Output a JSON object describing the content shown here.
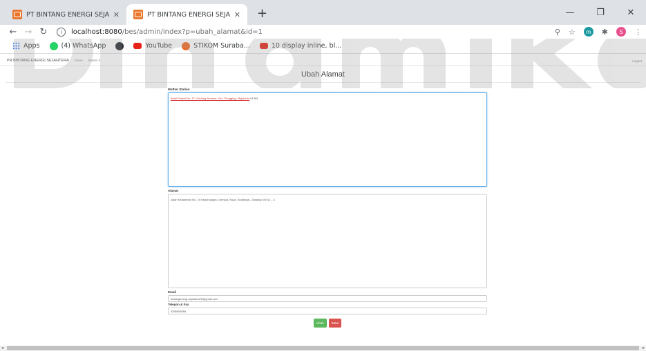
{
  "browser": {
    "tabs": [
      {
        "title": "PT BINTANG ENERGI SEJAHTERA",
        "active": false
      },
      {
        "title": "PT BINTANG ENERGI SEJAHTERA",
        "active": true
      }
    ],
    "url_host": "localhost:8080",
    "url_path": "/bes/admin/index?p=ubah_alamat&id=1",
    "bookmarks": [
      "Apps",
      "(4) WhatsApp",
      "YouTube",
      "STIKOM Suraba...",
      "10 display inline, bl..."
    ],
    "avatar_letter": "S",
    "ext_letter": "m"
  },
  "app": {
    "brand": "PR BINTANG ENERGI SEJAHTERA",
    "nav": [
      "Home",
      "Master ▾"
    ],
    "logout": "Logout"
  },
  "page": {
    "title": "Ubah Alamat"
  },
  "form": {
    "mother_station_label": "Mother Station",
    "mother_station_value_spell": "Balai Pertiwi No. 17, Gedung Nusana, Kec. Pungging, Mojokerto",
    "mother_station_value_rest": " 61384",
    "alamat_label": "Alamat",
    "alamat_value": "Jalan Kedamean No. 19 Kepuhungan, Gempol, Ruya, Surabaya – Malang KM 41 – 4",
    "email_label": "Email",
    "email_value": "bintangenergi.sejahtera78@gmail.com",
    "telepon_label": "Telepon & Fax",
    "telepon_value": "3355555555",
    "submit_label": "Ubah",
    "cancel_label": "Batal"
  },
  "watermark": "Dinamika"
}
